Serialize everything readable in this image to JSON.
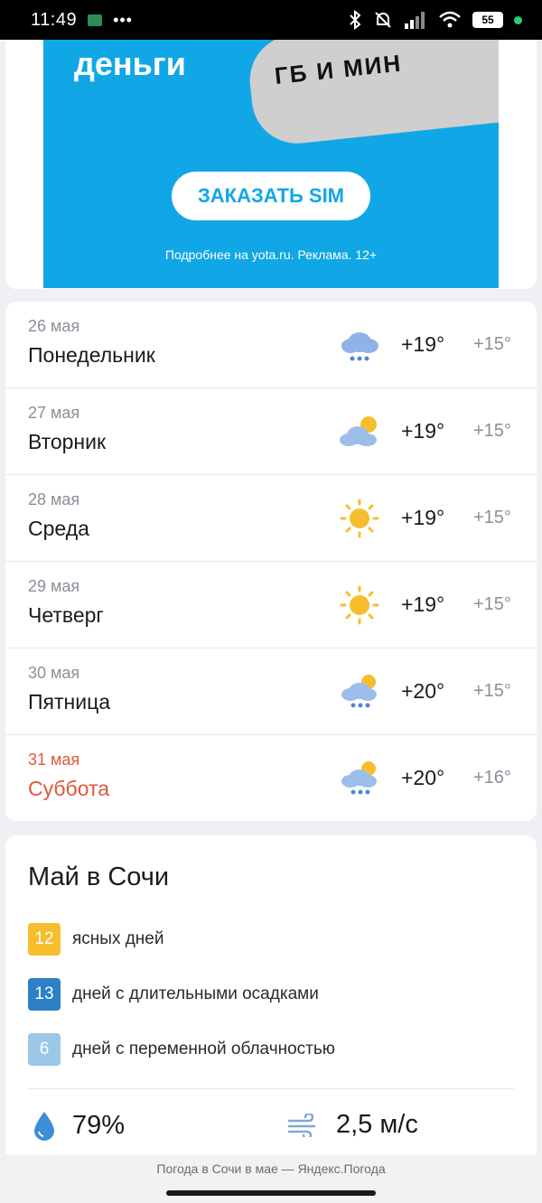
{
  "status_bar": {
    "time": "11:49",
    "dots": "•••",
    "battery": "55"
  },
  "ad": {
    "title": "деньги",
    "finger_text": "ГБ И МИН",
    "button_label": "ЗАКАЗАТЬ SIM",
    "note": "Подробнее на yota.ru. Реклама. 12+"
  },
  "forecast": [
    {
      "date": "26 мая",
      "day": "Понедельник",
      "icon": "rain-cloud-icon",
      "temp_day": "+19°",
      "temp_night": "+15°",
      "weekend": false
    },
    {
      "date": "27 мая",
      "day": "Вторник",
      "icon": "cloud-sun-icon",
      "temp_day": "+19°",
      "temp_night": "+15°",
      "weekend": false
    },
    {
      "date": "28 мая",
      "day": "Среда",
      "icon": "sun-icon",
      "temp_day": "+19°",
      "temp_night": "+15°",
      "weekend": false
    },
    {
      "date": "29 мая",
      "day": "Четверг",
      "icon": "sun-icon",
      "temp_day": "+19°",
      "temp_night": "+15°",
      "weekend": false
    },
    {
      "date": "30 мая",
      "day": "Пятница",
      "icon": "sun-rain-cloud-icon",
      "temp_day": "+20°",
      "temp_night": "+15°",
      "weekend": false
    },
    {
      "date": "31 мая",
      "day": "Суббота",
      "icon": "sun-rain-cloud-icon",
      "temp_day": "+20°",
      "temp_night": "+16°",
      "weekend": true
    }
  ],
  "month": {
    "title": "Май в Сочи",
    "stats": [
      {
        "value": "12",
        "label": "ясных дней",
        "color": "#f6be2e"
      },
      {
        "value": "13",
        "label": "дней с длительными осадками",
        "color": "#2d80c6"
      },
      {
        "value": "6",
        "label": "дней с переменной облачностью",
        "color": "#9cc7e6"
      }
    ],
    "humidity": "79%",
    "wind": "2,5 м/с"
  },
  "footer": {
    "text": "Погода в Сочи в мае — Яндекс.Погода"
  },
  "colors": {
    "accent_blue": "#11a7e6",
    "weekend_red": "#e0573a",
    "muted": "#8a8f99"
  }
}
